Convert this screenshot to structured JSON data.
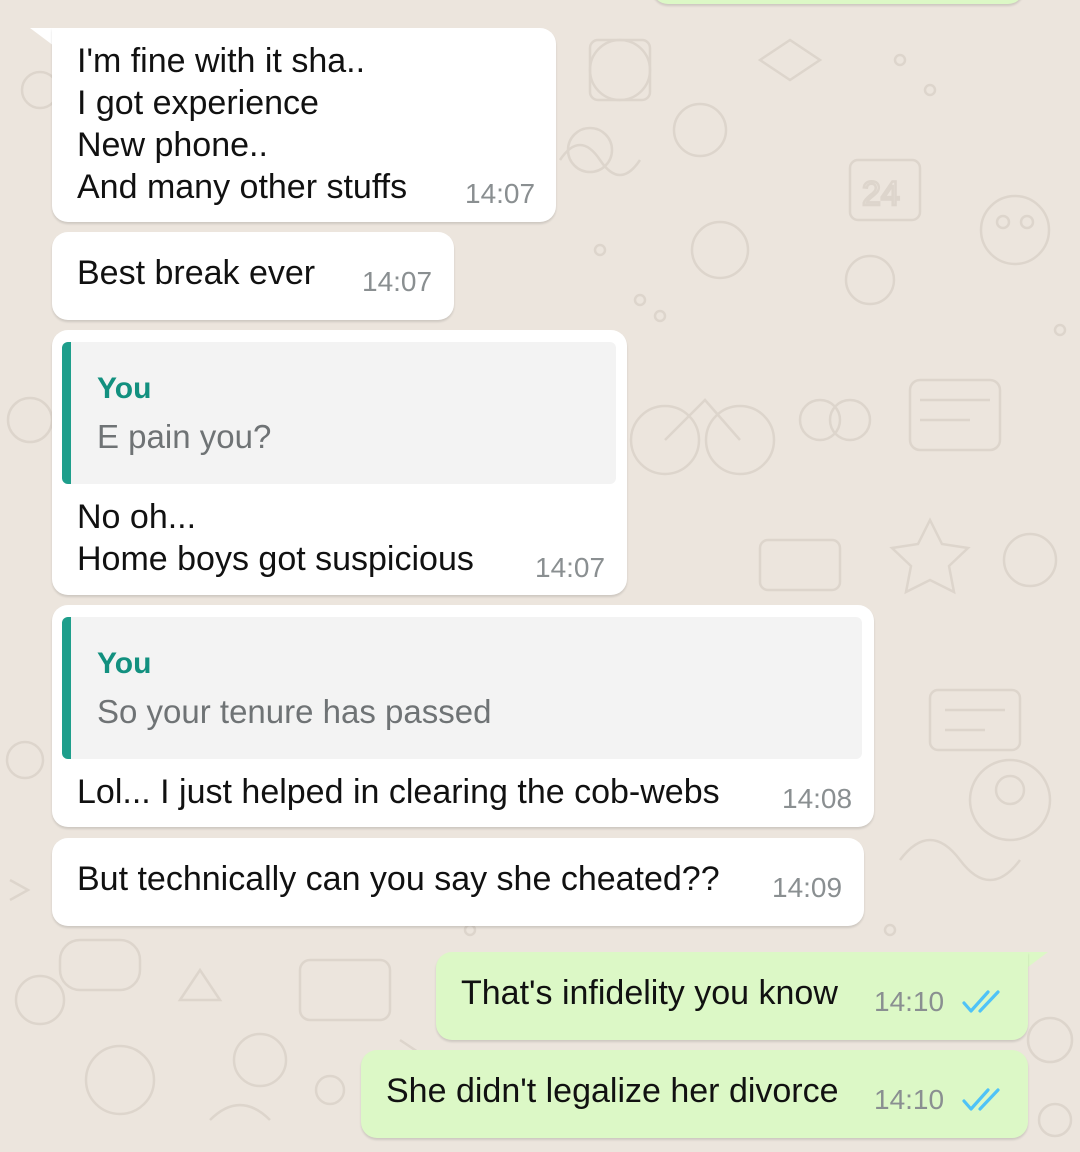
{
  "messages": [
    {
      "id": "m1",
      "direction": "incoming",
      "lines": [
        "I'm fine with it sha..",
        "I got experience",
        "New phone..",
        "And many other stuffs"
      ],
      "time": "14:07"
    },
    {
      "id": "m2",
      "direction": "incoming",
      "lines": [
        "Best break ever"
      ],
      "time": "14:07"
    },
    {
      "id": "m3",
      "direction": "incoming",
      "quote": {
        "author": "You",
        "text": "E pain you?"
      },
      "lines": [
        "No oh...",
        "Home boys got suspicious"
      ],
      "time": "14:07"
    },
    {
      "id": "m4",
      "direction": "incoming",
      "quote": {
        "author": "You",
        "text": "So your tenure has passed"
      },
      "lines": [
        "Lol... I just helped in clearing the cob-webs"
      ],
      "time": "14:08"
    },
    {
      "id": "m5",
      "direction": "incoming",
      "lines": [
        "But technically can you say she cheated??"
      ],
      "time": "14:09"
    },
    {
      "id": "m6",
      "direction": "outgoing",
      "lines": [
        "That's infidelity you know"
      ],
      "time": "14:10",
      "status": "read"
    },
    {
      "id": "m7",
      "direction": "outgoing",
      "lines": [
        "She didn't legalize her divorce"
      ],
      "time": "14:10",
      "status": "read"
    }
  ],
  "colors": {
    "incoming_bubble": "#ffffff",
    "outgoing_bubble": "#dcf8c6",
    "quote_accent": "#1e9e8b",
    "read_ticks": "#4fc3f7",
    "wallpaper": "#ece5dd"
  }
}
